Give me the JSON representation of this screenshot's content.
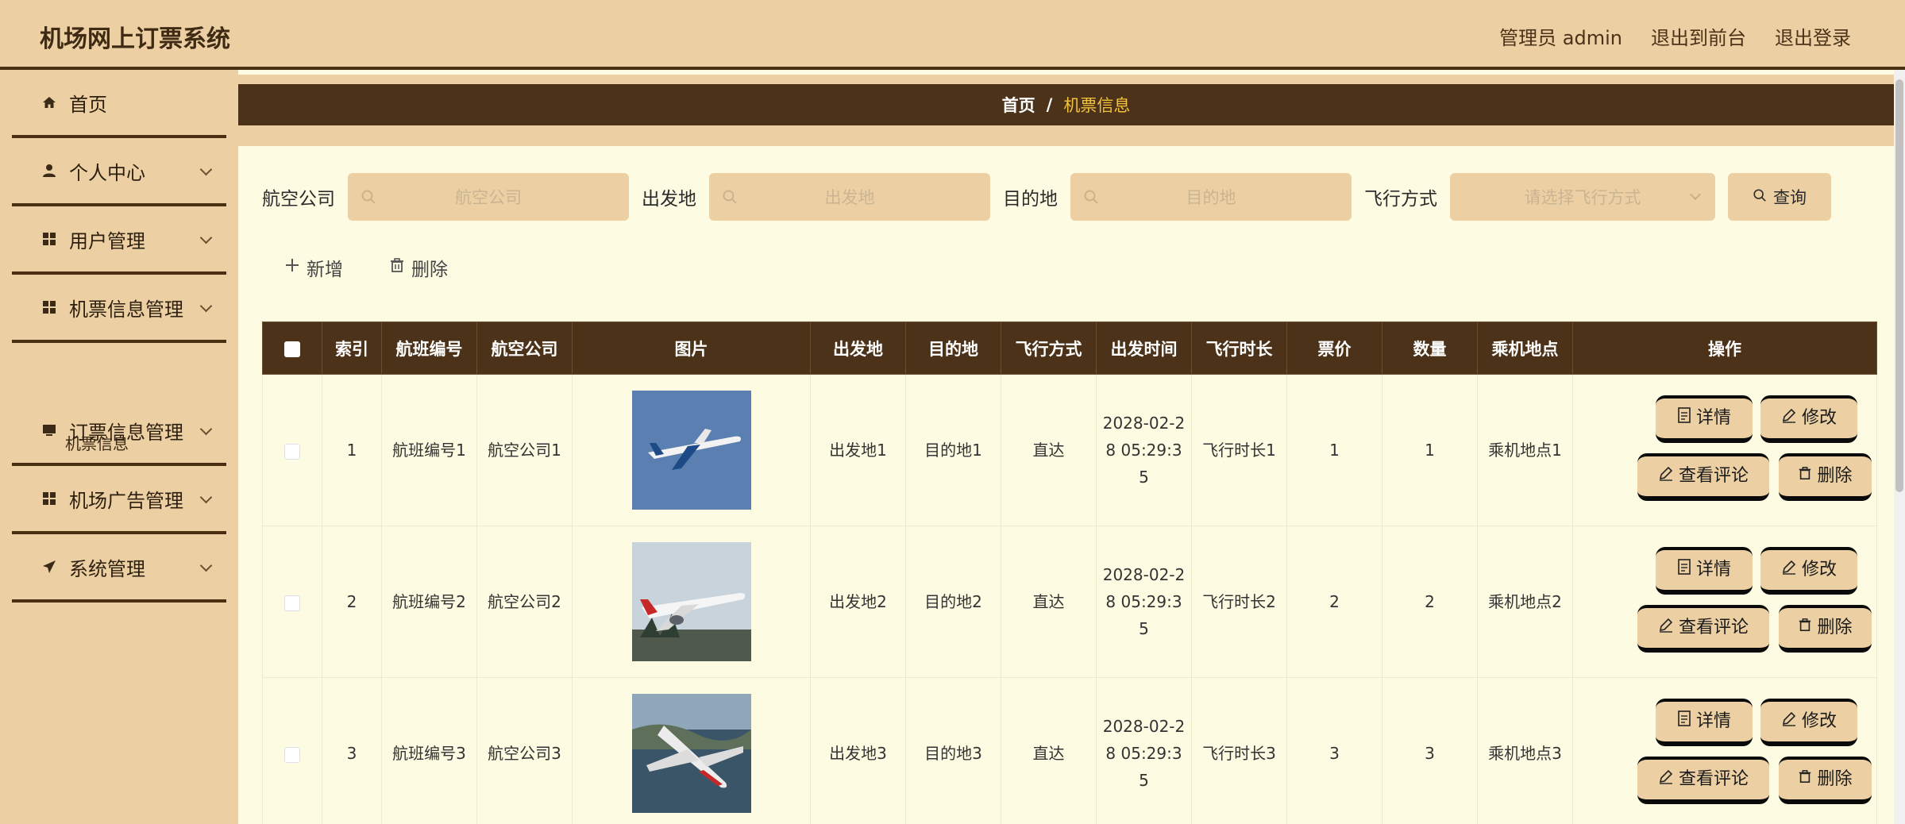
{
  "app": {
    "title": "机场网上订票系统",
    "admin": "管理员 admin",
    "to_front": "退出到前台",
    "logout": "退出登录"
  },
  "sidebar": {
    "items": [
      {
        "label": "首页",
        "icon": "home-icon"
      },
      {
        "label": "个人中心",
        "icon": "user-icon"
      },
      {
        "label": "用户管理",
        "icon": "grid-icon"
      },
      {
        "label": "机票信息管理",
        "icon": "grid-icon"
      },
      {
        "label": "订票信息管理",
        "icon": "monitor-icon"
      },
      {
        "label": "机场广告管理",
        "icon": "grid-icon"
      },
      {
        "label": "系统管理",
        "icon": "send-icon"
      }
    ],
    "sub_item": "机票信息"
  },
  "breadcrumb": {
    "home": "首页",
    "sep": "/",
    "current": "机票信息"
  },
  "search": {
    "airline_label": "航空公司",
    "airline_placeholder": "航空公司",
    "from_label": "出发地",
    "from_placeholder": "出发地",
    "to_label": "目的地",
    "to_placeholder": "目的地",
    "mode_label": "飞行方式",
    "mode_placeholder": "请选择飞行方式",
    "query_button": "查询"
  },
  "actions": {
    "add": "新增",
    "delete": "删除"
  },
  "table": {
    "headers": [
      "索引",
      "航班编号",
      "航空公司",
      "图片",
      "出发地",
      "目的地",
      "飞行方式",
      "出发时间",
      "飞行时长",
      "票价",
      "数量",
      "乘机地点",
      "操作"
    ],
    "rows": [
      {
        "index": "1",
        "flight_no": "航班编号1",
        "airline": "航空公司1",
        "from": "出发地1",
        "to": "目的地1",
        "mode": "直达",
        "depart": "2028-02-28 05:29:35",
        "duration": "飞行时长1",
        "price": "1",
        "qty": "1",
        "location": "乘机地点1"
      },
      {
        "index": "2",
        "flight_no": "航班编号2",
        "airline": "航空公司2",
        "from": "出发地2",
        "to": "目的地2",
        "mode": "直达",
        "depart": "2028-02-28 05:29:35",
        "duration": "飞行时长2",
        "price": "2",
        "qty": "2",
        "location": "乘机地点2"
      },
      {
        "index": "3",
        "flight_no": "航班编号3",
        "airline": "航空公司3",
        "from": "出发地3",
        "to": "目的地3",
        "mode": "直达",
        "depart": "2028-02-28 05:29:35",
        "duration": "飞行时长3",
        "price": "3",
        "qty": "3",
        "location": "乘机地点3"
      }
    ],
    "ops": {
      "detail": "详情",
      "edit": "修改",
      "comments": "查看评论",
      "delete": "删除"
    }
  },
  "colors": {
    "header_bg": "#ecd0a3",
    "accent_dark": "#4b3218",
    "content_bg": "#fdfce2",
    "breadcrumb_current": "#f3c33f"
  }
}
